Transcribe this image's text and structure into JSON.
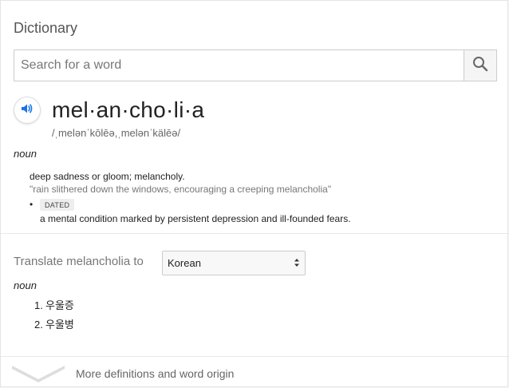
{
  "header": {
    "title": "Dictionary"
  },
  "search": {
    "placeholder": "Search for a word",
    "value": ""
  },
  "entry": {
    "word": "mel·an·cho·li·a",
    "phonetic": "/ˌmelənˈkōlēə,ˌmelənˈkälēə/",
    "part_of_speech": "noun",
    "definitions": [
      {
        "text": "deep sadness or gloom; melancholy.",
        "example": "\"rain slithered down the windows, encouraging a creeping melancholia\""
      },
      {
        "label": "DATED",
        "text": "a mental condition marked by persistent depression and ill-founded fears."
      }
    ]
  },
  "translate": {
    "label": "Translate melancholia to",
    "language": "Korean",
    "part_of_speech": "noun",
    "items": [
      {
        "num": "1.",
        "text": "우울증"
      },
      {
        "num": "2.",
        "text": "우울병"
      }
    ]
  },
  "footer": {
    "more_label": "More definitions and word origin"
  },
  "icons": {
    "search": "search-icon",
    "speaker": "speaker-icon",
    "chevron": "chevron-down-icon"
  },
  "colors": {
    "accent": "#1a73e8"
  }
}
